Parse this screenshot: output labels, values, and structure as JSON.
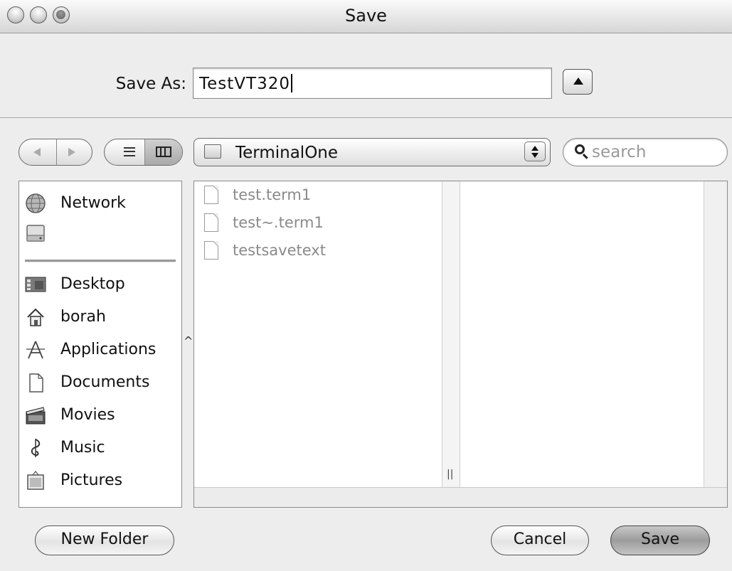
{
  "window": {
    "title": "Save"
  },
  "save_as": {
    "label": "Save As:",
    "value": "TestVT320"
  },
  "location": {
    "folder": "TerminalOne"
  },
  "search": {
    "placeholder": "search"
  },
  "sidebar": {
    "devices": [
      {
        "label": "Network",
        "icon": "network-globe-icon"
      },
      {
        "label": "",
        "icon": "hard-disk-icon"
      }
    ],
    "places": [
      {
        "label": "Desktop",
        "icon": "desktop-icon"
      },
      {
        "label": "borah",
        "icon": "home-icon"
      },
      {
        "label": "Applications",
        "icon": "applications-icon"
      },
      {
        "label": "Documents",
        "icon": "documents-icon"
      },
      {
        "label": "Movies",
        "icon": "movies-icon"
      },
      {
        "label": "Music",
        "icon": "music-icon"
      },
      {
        "label": "Pictures",
        "icon": "pictures-icon"
      }
    ]
  },
  "files": [
    {
      "name": "test.term1"
    },
    {
      "name": "test~.term1"
    },
    {
      "name": "testsavetext"
    }
  ],
  "buttons": {
    "new_folder": "New Folder",
    "cancel": "Cancel",
    "save": "Save"
  }
}
